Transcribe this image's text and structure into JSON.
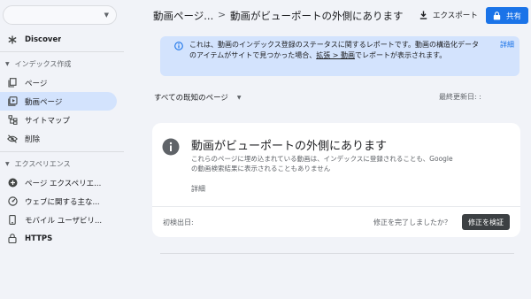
{
  "sidebar": {
    "property_selector_value": "",
    "items_top": [
      {
        "label": "Discover",
        "icon": "asterisk-icon"
      }
    ],
    "section_index": {
      "title": "インデックス作成",
      "items": [
        {
          "label": "ページ",
          "icon": "page-copy-icon"
        },
        {
          "label": "動画ページ",
          "icon": "video-page-icon",
          "active": true
        },
        {
          "label": "サイトマップ",
          "icon": "sitemap-icon"
        },
        {
          "label": "削除",
          "icon": "visibility-off-icon"
        }
      ]
    },
    "section_experience": {
      "title": "エクスペリエンス",
      "items": [
        {
          "label": "ページ エクスペリエ...",
          "icon": "plus-circle-icon"
        },
        {
          "label": "ウェブに関する主な...",
          "icon": "gauge-icon"
        },
        {
          "label": "モバイル ユーザビリ...",
          "icon": "phone-icon"
        },
        {
          "label": "HTTPS",
          "icon": "lock-icon"
        }
      ]
    }
  },
  "header": {
    "breadcrumb_parent": "動画ページ...",
    "breadcrumb_separator": ">",
    "breadcrumb_current": "動画がビューポートの外側にあります",
    "export_label": "エクスポート",
    "share_label": "共有"
  },
  "banner": {
    "text_before_link": "これは、動画のインデックス登録のステータスに関するレポートです。動画の構造化データのアイテムがサイトで見つかった場合、",
    "link_text": "拡張 > 動画",
    "text_after_link": "でレポートが表示されます。",
    "detail_link": "詳細"
  },
  "filter": {
    "selected": "すべての既知のページ",
    "last_updated": "最終更新日: :"
  },
  "issue_card": {
    "title": "動画がビューポートの外側にあります",
    "description": "これらのページに埋め込まれている動画は、インデックスに登録されることも、Google の動画検索結果に表示されることもありません",
    "detail_link": "詳細",
    "first_detected": "初検出日:",
    "fix_question": "修正を完了しましたか？",
    "verify_button": "修正を検証"
  },
  "colors": {
    "accent": "#1a73e8",
    "active_nav": "#d3e3fd",
    "banner_bg": "#d3e3fd",
    "page_bg": "#f1f3f8",
    "verify_btn": "#3c4043"
  }
}
